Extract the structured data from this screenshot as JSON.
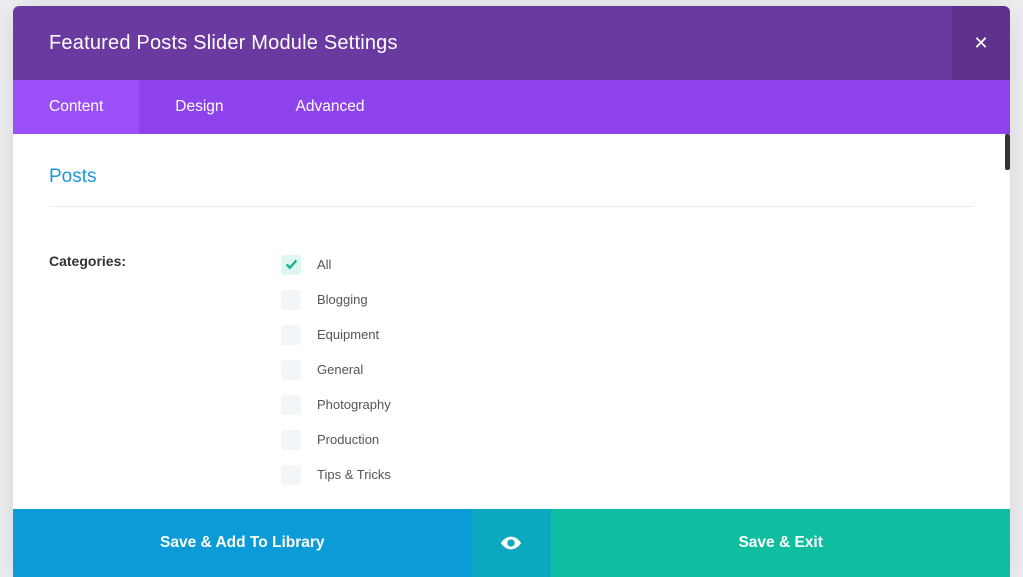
{
  "header": {
    "title": "Featured Posts Slider Module Settings"
  },
  "tabs": [
    {
      "label": "Content",
      "active": true
    },
    {
      "label": "Design",
      "active": false
    },
    {
      "label": "Advanced",
      "active": false
    }
  ],
  "section": {
    "title": "Posts",
    "field_label": "Categories:",
    "categories": [
      {
        "label": "All",
        "checked": true
      },
      {
        "label": "Blogging",
        "checked": false
      },
      {
        "label": "Equipment",
        "checked": false
      },
      {
        "label": "General",
        "checked": false
      },
      {
        "label": "Photography",
        "checked": false
      },
      {
        "label": "Production",
        "checked": false
      },
      {
        "label": "Tips & Tricks",
        "checked": false
      }
    ]
  },
  "footer": {
    "save_add_library": "Save & Add To Library",
    "save_exit": "Save & Exit"
  }
}
